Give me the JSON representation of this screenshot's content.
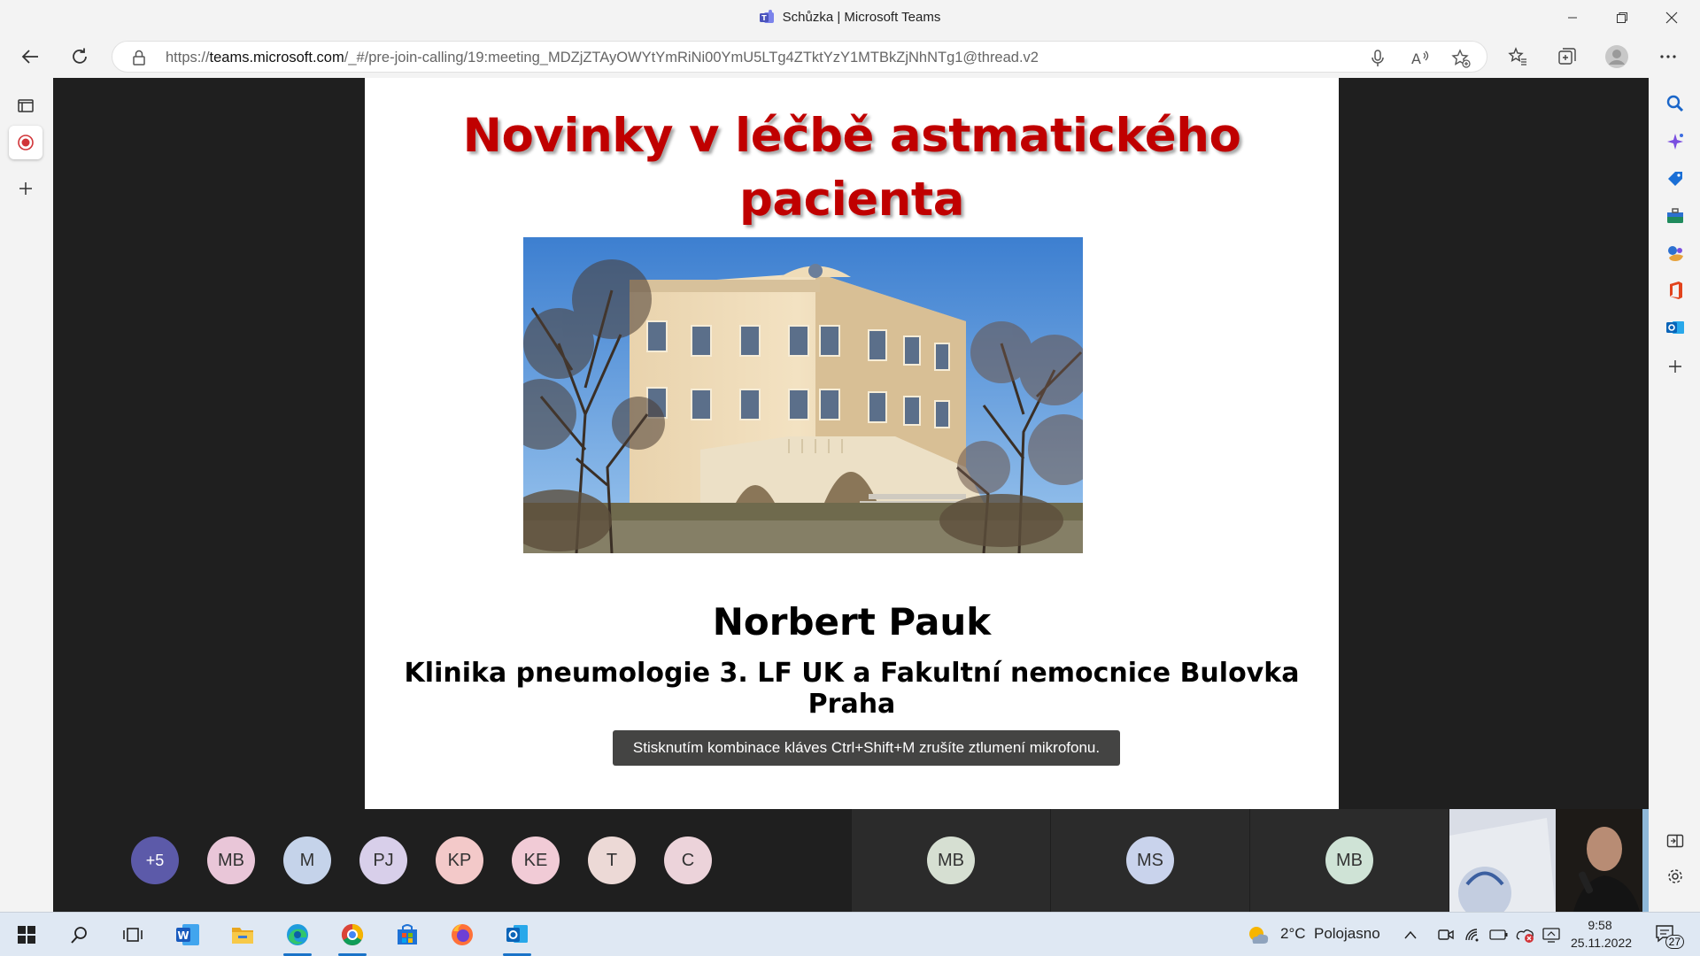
{
  "window": {
    "title": "Schůzka | Microsoft Teams",
    "controls": [
      "minimize",
      "restore",
      "close"
    ]
  },
  "address_bar": {
    "url_prefix": "https://",
    "url_domain": "teams.microsoft.com",
    "url_path": "/_#/pre-join-calling/19:meeting_MDZjZTAyOWYtYmRiNi00YmU5LTg4ZTktYzY1MTBkZjNhNTg1@thread.v2"
  },
  "slide": {
    "heading_line1": "Novinky v léčbě astmatického",
    "heading_line2": "pacienta",
    "presenter_name": "Norbert Pauk",
    "clinic": "Klinika pneumologie 3. LF UK a Fakultní nemocnice Bulovka Praha"
  },
  "toast": {
    "text": "Stisknutím kombinace kláves Ctrl+Shift+M zrušíte ztlumení mikrofonu."
  },
  "participants": {
    "overflow": "+5",
    "avatars": [
      {
        "initials": "MB",
        "color": "#e9c6d8"
      },
      {
        "initials": "M",
        "color": "#c5d3ea"
      },
      {
        "initials": "PJ",
        "color": "#d8cfea"
      },
      {
        "initials": "KP",
        "color": "#f3c9c9"
      },
      {
        "initials": "KE",
        "color": "#f1cbd6"
      },
      {
        "initials": "T",
        "color": "#ecd9d6"
      },
      {
        "initials": "C",
        "color": "#ecd3da"
      }
    ],
    "tiles": [
      {
        "initials": "MB",
        "color": "#d6dfd2"
      },
      {
        "initials": "MS",
        "color": "#c9d3ec"
      },
      {
        "initials": "MB",
        "color": "#cfe3d6"
      }
    ],
    "overflow_color": "#5c5aa9"
  },
  "taskbar": {
    "weather_temp": "2°C",
    "weather_text": "Polojasno",
    "time": "9:58",
    "date": "25.11.2022",
    "notification_count": "27"
  },
  "colors": {
    "heading": "#c00000",
    "stage_bg": "#1f1f1f",
    "chrome_bg": "#f3f3f3"
  }
}
